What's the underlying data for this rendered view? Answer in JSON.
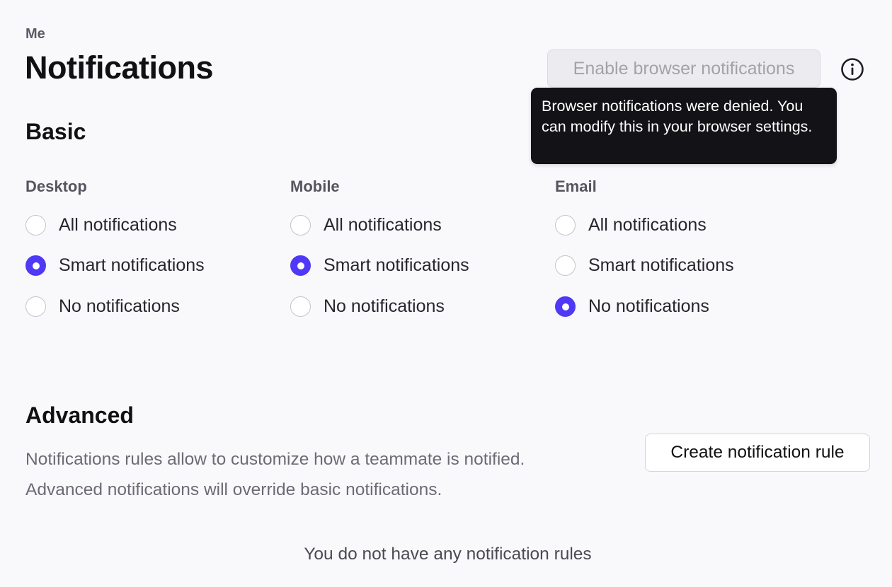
{
  "breadcrumb": "Me",
  "title": "Notifications",
  "enable_browser_button": "Enable browser notifications",
  "info_icon": "info-circle-icon",
  "tooltip": "Browser notifications were denied. You can modify this in your browser settings.",
  "basic": {
    "title": "Basic",
    "columns": [
      {
        "heading": "Desktop",
        "options": [
          "All notifications",
          "Smart notifications",
          "No notifications"
        ],
        "selected": "Smart notifications"
      },
      {
        "heading": "Mobile",
        "options": [
          "All notifications",
          "Smart notifications",
          "No notifications"
        ],
        "selected": "Smart notifications"
      },
      {
        "heading": "Email",
        "options": [
          "All notifications",
          "Smart notifications",
          "No notifications"
        ],
        "selected": "No notifications"
      }
    ]
  },
  "advanced": {
    "title": "Advanced",
    "description_line1": "Notifications rules allow to customize how a teammate is notified.",
    "description_line2": "Advanced notifications will override basic notifications.",
    "create_button": "Create notification rule",
    "empty_state": "You do not have any notification rules"
  },
  "colors": {
    "accent": "#4f39f6",
    "tooltip_bg": "#131317",
    "page_bg": "#f9f9fc"
  }
}
